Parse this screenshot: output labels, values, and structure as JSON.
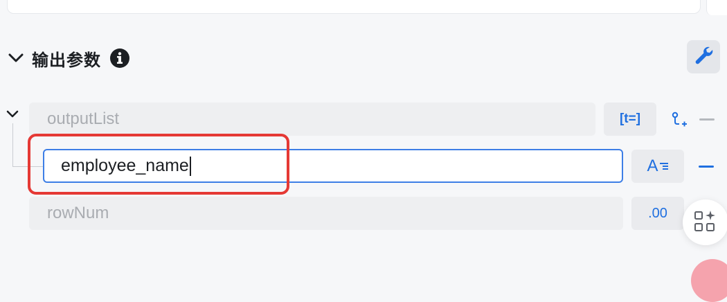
{
  "section": {
    "title": "输出参数"
  },
  "params": [
    {
      "name": "outputList",
      "type_label": "[t=]",
      "type_icon": "array-type-icon",
      "state": "disabled"
    },
    {
      "name": "employee_name",
      "type_label": "A",
      "type_icon": "string-type-icon",
      "state": "editing"
    },
    {
      "name": "rowNum",
      "type_label": ".00",
      "type_icon": "number-type-icon",
      "state": "disabled"
    }
  ],
  "colors": {
    "accent": "#1f6fe0",
    "focus_border": "#3d7ee6",
    "highlight": "#e53935",
    "disabled_text": "#a9acb1"
  }
}
